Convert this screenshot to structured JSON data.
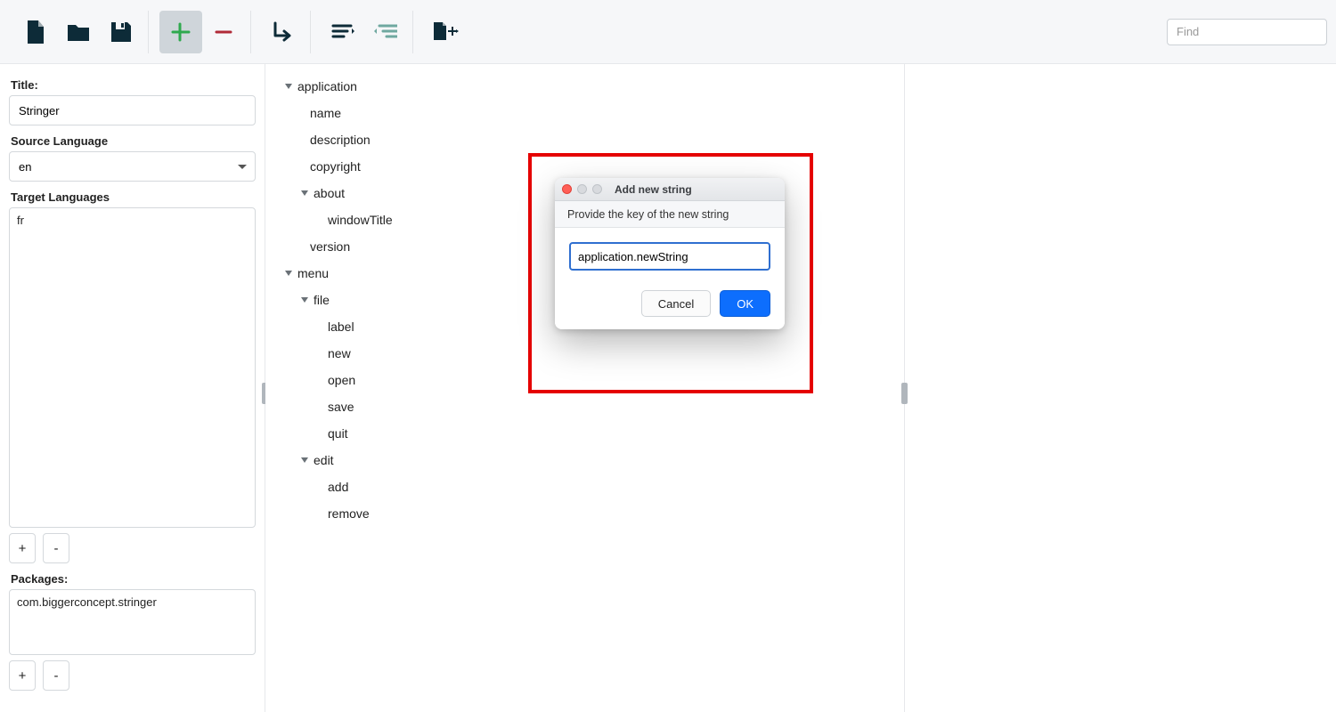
{
  "toolbar": {
    "find_placeholder": "Find"
  },
  "sidebar": {
    "title_label": "Title:",
    "title_value": "Stringer",
    "source_language_label": "Source Language",
    "source_language_value": "en",
    "target_languages_label": "Target Languages",
    "target_languages": [
      "fr"
    ],
    "add_symbol": "+",
    "remove_symbol": "-",
    "packages_label": "Packages:",
    "packages": [
      "com.biggerconcept.stringer"
    ]
  },
  "tree": {
    "nodes": [
      {
        "depth": 0,
        "expandable": true,
        "key": "application"
      },
      {
        "depth": 1,
        "expandable": false,
        "key": "name"
      },
      {
        "depth": 1,
        "expandable": false,
        "key": "description"
      },
      {
        "depth": 1,
        "expandable": false,
        "key": "copyright"
      },
      {
        "depth": 1,
        "expandable": true,
        "key": "about"
      },
      {
        "depth": 2,
        "expandable": false,
        "key": "windowTitle"
      },
      {
        "depth": 1,
        "expandable": false,
        "key": "version"
      },
      {
        "depth": 0,
        "expandable": true,
        "key": "menu"
      },
      {
        "depth": 1,
        "expandable": true,
        "key": "file"
      },
      {
        "depth": 2,
        "expandable": false,
        "key": "label"
      },
      {
        "depth": 2,
        "expandable": false,
        "key": "new"
      },
      {
        "depth": 2,
        "expandable": false,
        "key": "open"
      },
      {
        "depth": 2,
        "expandable": false,
        "key": "save"
      },
      {
        "depth": 2,
        "expandable": false,
        "key": "quit"
      },
      {
        "depth": 1,
        "expandable": true,
        "key": "edit"
      },
      {
        "depth": 2,
        "expandable": false,
        "key": "add"
      },
      {
        "depth": 2,
        "expandable": false,
        "key": "remove"
      }
    ]
  },
  "dialog": {
    "title": "Add new string",
    "prompt": "Provide the key of the new string",
    "input_value": "application.newString",
    "cancel_label": "Cancel",
    "ok_label": "OK"
  }
}
